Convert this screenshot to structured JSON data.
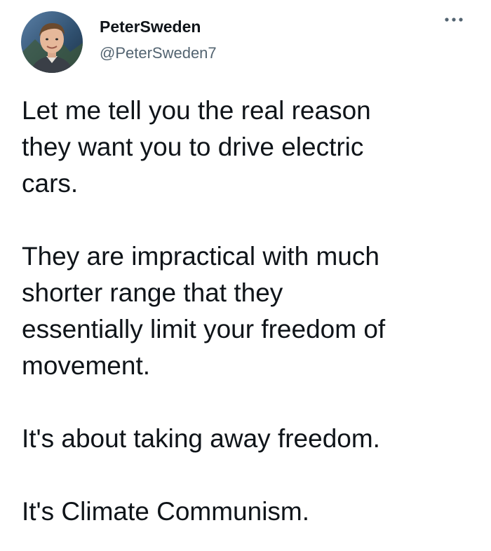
{
  "tweet": {
    "author": {
      "display_name": "PeterSweden",
      "handle": "@PeterSweden7",
      "avatar_icon": "profile-photo"
    },
    "more_icon": "ellipsis-icon",
    "paragraphs": [
      "Let me tell you the real reason\nthey want you to drive electric\ncars.",
      "They are impractical with much\nshorter range that they\nessentially limit your freedom of\nmovement.",
      "It's about taking away freedom.",
      "It's Climate Communism."
    ]
  },
  "colors": {
    "text": "#0f1419",
    "secondary_text": "#536471",
    "background": "#ffffff"
  }
}
